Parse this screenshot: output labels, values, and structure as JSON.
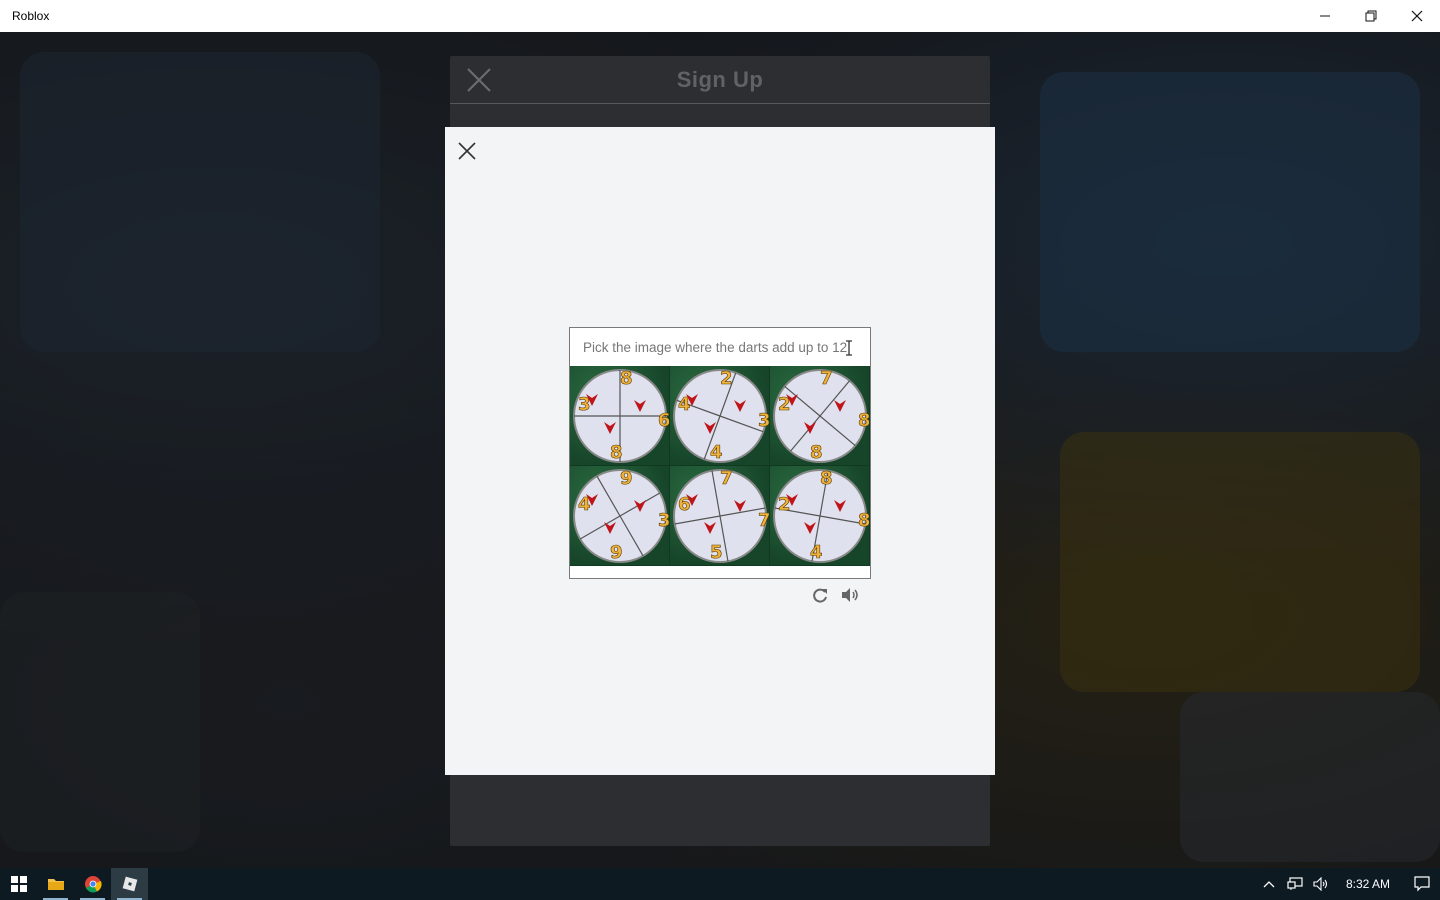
{
  "window": {
    "title": "Roblox"
  },
  "signup": {
    "title": "Sign Up"
  },
  "captcha": {
    "prompt": "Pick the image where the darts add up to 12",
    "tiles": [
      {
        "numbers": [
          "8",
          "3",
          "6",
          "8"
        ]
      },
      {
        "numbers": [
          "2",
          "4",
          "3",
          "4"
        ]
      },
      {
        "numbers": [
          "7",
          "2",
          "8",
          "8"
        ]
      },
      {
        "numbers": [
          "9",
          "4",
          "3",
          "9"
        ]
      },
      {
        "numbers": [
          "7",
          "6",
          "7",
          "5"
        ]
      },
      {
        "numbers": [
          "8",
          "2",
          "8",
          "4"
        ]
      }
    ]
  },
  "taskbar": {
    "time": "8:32 AM"
  },
  "colors": {
    "tile_green": "#1f5a34",
    "dart_red": "#c0141b",
    "number_gold": "#f0b23a",
    "board_white": "#dfe2ee"
  }
}
